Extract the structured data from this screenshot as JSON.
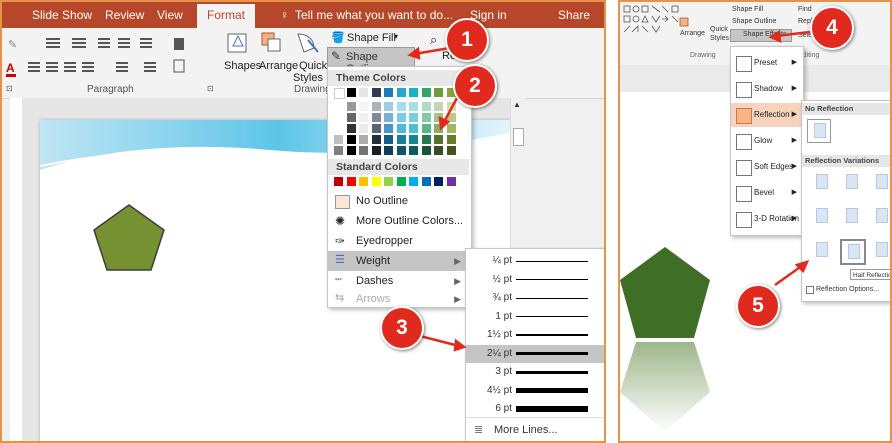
{
  "tabs": [
    "Slide Show",
    "Review",
    "View",
    "Format"
  ],
  "tell_me": "Tell me what you want to do...",
  "sign_in": "Sign in",
  "share": "Share",
  "ribbon": {
    "shapes": "Shapes",
    "arrange": "Arrange",
    "quick": "Quick",
    "styles": "Styles",
    "shape_fill": "Shape Fill",
    "shape_outline": "Shape Outline",
    "paragraph": "Paragraph",
    "drawing": "Drawing",
    "find_short": "Re"
  },
  "outline_menu": {
    "theme_header": "Theme Colors",
    "standard_header": "Standard Colors",
    "no_outline": "No Outline",
    "more_colors": "More Outline Colors...",
    "eyedropper": "Eyedropper",
    "weight": "Weight",
    "dashes": "Dashes",
    "arrows": "Arrows"
  },
  "theme_colors_top": [
    "#ffffff",
    "#000000",
    "#e7e6e6",
    "#2c3e50",
    "#1a7bb8",
    "#24a6d1",
    "#1ab3c4",
    "#31a56a",
    "#6e9b3b",
    "#8aa53a"
  ],
  "standard_colors": [
    "#c00000",
    "#ff0000",
    "#ffc000",
    "#ffff00",
    "#92d050",
    "#00b050",
    "#00b0f0",
    "#0070c0",
    "#002060",
    "#7030a0"
  ],
  "weight_menu": {
    "items": [
      "¼ pt",
      "½ pt",
      "¾ pt",
      "1 pt",
      "1½ pt",
      "2¼ pt",
      "3 pt",
      "4½ pt",
      "6 pt"
    ],
    "more_lines": "More Lines...",
    "selected": "2¼ pt"
  },
  "right": {
    "ribbon": {
      "shape_fill": "Shape Fill",
      "shape_outline": "Shape Outline",
      "shape_effects": "Shape Effects",
      "find": "Find",
      "replace": "Repl",
      "select": "Select",
      "arrange": "Arrange",
      "quick": "Quick",
      "styles": "Styles",
      "drawing": "Drawing",
      "editing": "Editing"
    },
    "effects_menu": [
      "Preset",
      "Shadow",
      "Reflection",
      "Glow",
      "Soft Edges",
      "Bevel",
      "3-D Rotation"
    ],
    "reflection_panel": {
      "no_reflection": "No Reflection",
      "variations": "Reflection Variations",
      "tooltip": "Half Reflection,",
      "options": "Reflection Options..."
    }
  },
  "callouts": [
    "1",
    "2",
    "3",
    "4",
    "5"
  ],
  "colors": {
    "brand": "#b7472a",
    "callout": "#e12a1e",
    "pentagon": "#769131",
    "panel_border": "#e8914a"
  }
}
